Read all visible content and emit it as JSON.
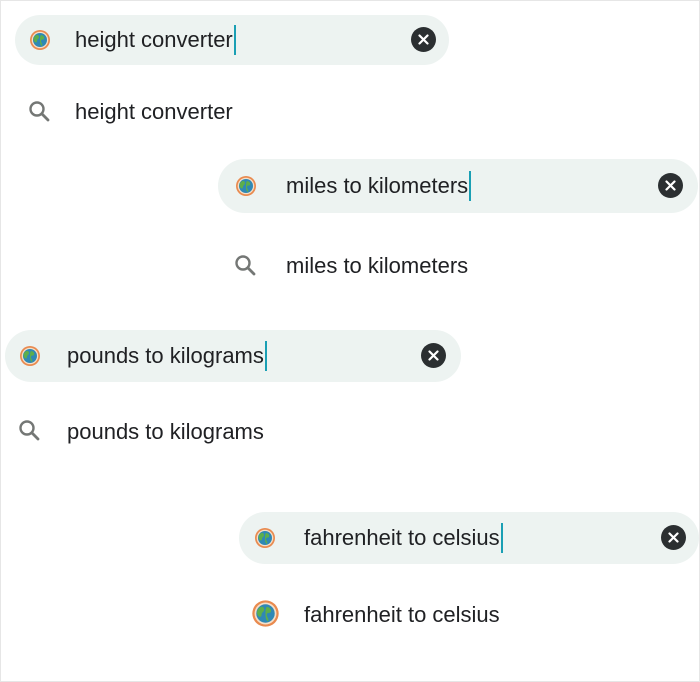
{
  "groups": [
    {
      "query": "height converter",
      "suggestion": "height converter",
      "query_icon": "globe-icon",
      "suggestion_icon": "search-icon",
      "clear_icon": "clear-icon"
    },
    {
      "query": "miles to kilometers",
      "suggestion": "miles to kilometers",
      "query_icon": "globe-icon",
      "suggestion_icon": "search-icon",
      "clear_icon": "clear-icon"
    },
    {
      "query": "pounds to kilograms",
      "suggestion": "pounds to kilograms",
      "query_icon": "globe-icon",
      "suggestion_icon": "search-icon",
      "clear_icon": "clear-icon"
    },
    {
      "query": "fahrenheit to celsius",
      "suggestion": "fahrenheit to celsius",
      "query_icon": "globe-icon",
      "suggestion_icon": "globe-icon",
      "clear_icon": "clear-icon"
    }
  ],
  "colors": {
    "bar_background": "#edf3f1",
    "caret": "#1a9fb4",
    "clear_button": "#2b2f31",
    "search_icon": "#747775"
  }
}
